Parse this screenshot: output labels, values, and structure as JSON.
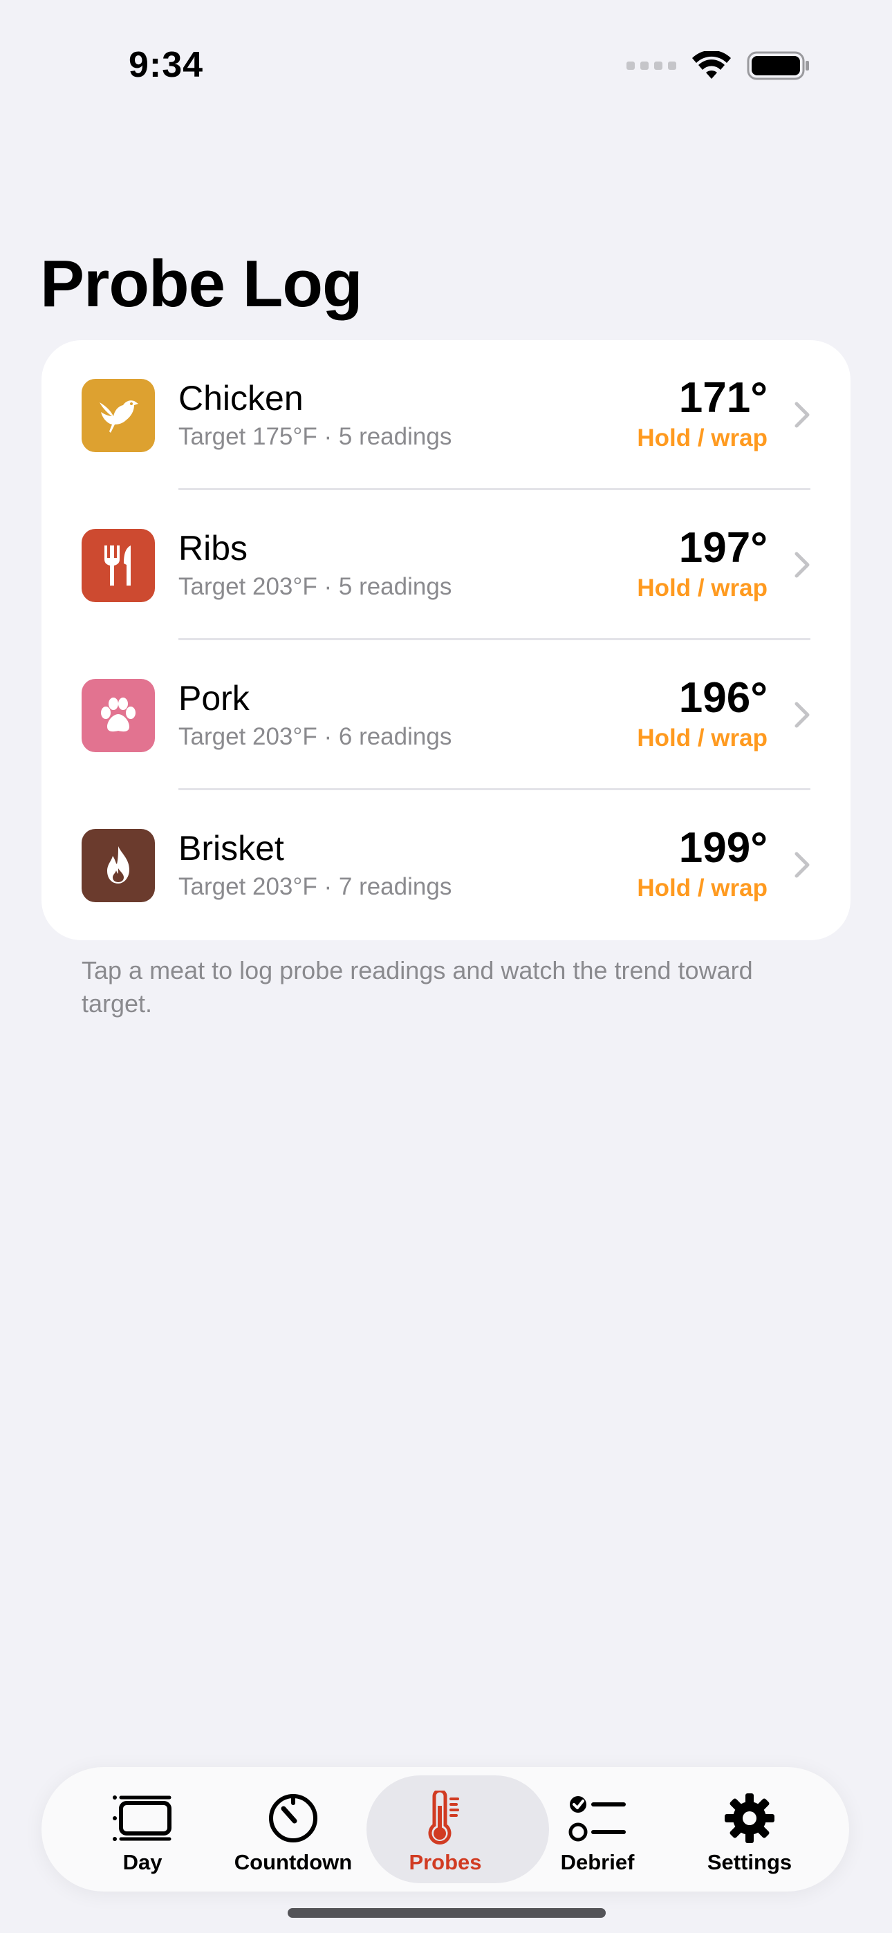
{
  "status_bar": {
    "time": "9:34"
  },
  "page": {
    "title": "Probe Log",
    "footer_note": "Tap a meat to log probe readings and watch the trend toward target."
  },
  "colors": {
    "accent": "#d13b22",
    "status_orange": "#ff9a1f",
    "background": "#f2f2f7"
  },
  "meats": [
    {
      "name": "Chicken",
      "subtitle": "Target 175°F · 5 readings",
      "temp": "171°",
      "status": "Hold / wrap",
      "icon": "bird-icon",
      "icon_color": "#dda130"
    },
    {
      "name": "Ribs",
      "subtitle": "Target 203°F · 5 readings",
      "temp": "197°",
      "status": "Hold / wrap",
      "icon": "fork-knife-icon",
      "icon_color": "#cd4a30"
    },
    {
      "name": "Pork",
      "subtitle": "Target 203°F · 6 readings",
      "temp": "196°",
      "status": "Hold / wrap",
      "icon": "paw-icon",
      "icon_color": "#e27390"
    },
    {
      "name": "Brisket",
      "subtitle": "Target 203°F · 7 readings",
      "temp": "199°",
      "status": "Hold / wrap",
      "icon": "flame-icon",
      "icon_color": "#6b3b2d"
    }
  ],
  "tabs": [
    {
      "label": "Day",
      "icon": "day-list-icon"
    },
    {
      "label": "Countdown",
      "icon": "timer-icon"
    },
    {
      "label": "Probes",
      "icon": "thermometer-icon",
      "active": true
    },
    {
      "label": "Debrief",
      "icon": "checklist-icon"
    },
    {
      "label": "Settings",
      "icon": "gear-icon"
    }
  ]
}
